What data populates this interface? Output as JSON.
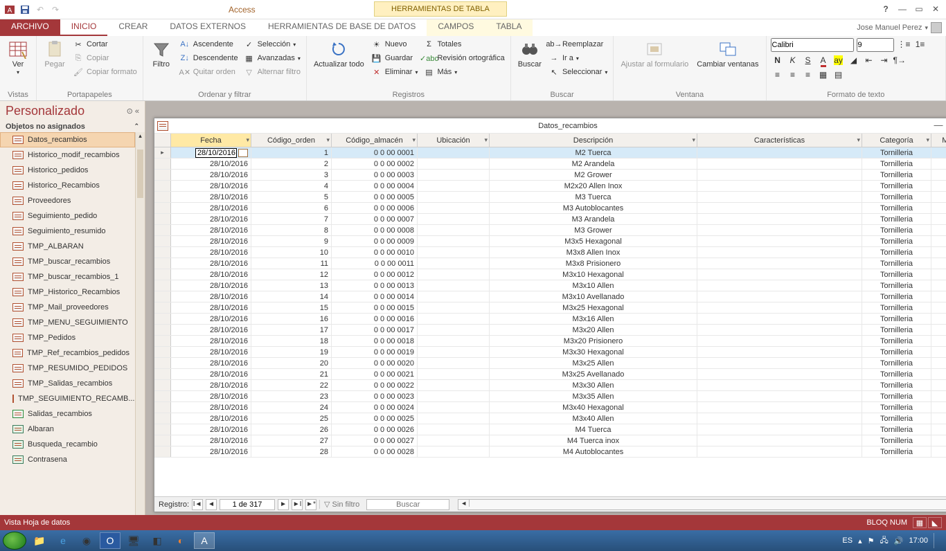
{
  "titlebar": {
    "app_title": "Access",
    "context_group": "HERRAMIENTAS DE TABLA"
  },
  "tabs": {
    "file": "ARCHIVO",
    "home": "INICIO",
    "create": "CREAR",
    "external": "DATOS EXTERNOS",
    "dbtools": "HERRAMIENTAS DE BASE DE DATOS",
    "fields": "CAMPOS",
    "table": "TABLA"
  },
  "user_name": "Jose Manuel Perez",
  "ribbon": {
    "views": {
      "btn": "Ver",
      "label": "Vistas"
    },
    "clipboard": {
      "paste": "Pegar",
      "cut": "Cortar",
      "copy": "Copiar",
      "format_painter": "Copiar formato",
      "label": "Portapapeles"
    },
    "sortfilter": {
      "filter": "Filtro",
      "asc": "Ascendente",
      "desc": "Descendente",
      "clear_sort": "Quitar orden",
      "selection": "Selección",
      "advanced": "Avanzadas",
      "toggle_filter": "Alternar filtro",
      "label": "Ordenar y filtrar"
    },
    "records": {
      "refresh": "Actualizar todo",
      "new": "Nuevo",
      "save": "Guardar",
      "delete": "Eliminar",
      "totals": "Totales",
      "spelling": "Revisión ortográfica",
      "more": "Más",
      "label": "Registros"
    },
    "find": {
      "find": "Buscar",
      "replace": "Reemplazar",
      "goto": "Ir a",
      "select": "Seleccionar",
      "label": "Buscar"
    },
    "window": {
      "size_to_fit": "Ajustar al formulario",
      "switch": "Cambiar ventanas",
      "label": "Ventana"
    },
    "textfmt": {
      "font_name": "Calibri",
      "font_size": "9",
      "label": "Formato de texto"
    }
  },
  "nav": {
    "title": "Personalizado",
    "subtitle": "Objetos no asignados",
    "items": [
      "Datos_recambios",
      "Historico_modif_recambios",
      "Historico_pedidos",
      "Historico_Recambios",
      "Proveedores",
      "Seguimiento_pedido",
      "Seguimiento_resumido",
      "TMP_ALBARAN",
      "TMP_buscar_recambios",
      "TMP_buscar_recambios_1",
      "TMP_Historico_Recambios",
      "TMP_Mail_proveedores",
      "TMP_MENU_SEGUIMIENTO",
      "TMP_Pedidos",
      "TMP_Ref_recambios_pedidos",
      "TMP_RESUMIDO_PEDIDOS",
      "TMP_Salidas_recambios",
      "TMP_SEGUIMIENTO_RECAMB...",
      "Salidas_recambios",
      "Albaran",
      "Busqueda_recambio",
      "Contrasena"
    ]
  },
  "doc": {
    "title": "Datos_recambios",
    "columns": [
      "Fecha",
      "Código_orden",
      "Código_almacén",
      "Ubicación",
      "Descripción",
      "Características",
      "Categoría",
      "Mont"
    ],
    "active_cell_value": "28/10/2016",
    "rows": [
      [
        "28/10/2016",
        "1",
        "0 0 00 0001",
        "",
        "M2 Tuerca",
        "",
        "Tornilleria"
      ],
      [
        "28/10/2016",
        "2",
        "0 0 00 0002",
        "",
        "M2 Arandela",
        "",
        "Tornilleria"
      ],
      [
        "28/10/2016",
        "3",
        "0 0 00 0003",
        "",
        "M2 Grower",
        "",
        "Tornilleria"
      ],
      [
        "28/10/2016",
        "4",
        "0 0 00 0004",
        "",
        "M2x20 Allen Inox",
        "",
        "Tornilleria"
      ],
      [
        "28/10/2016",
        "5",
        "0 0 00 0005",
        "",
        "M3 Tuerca",
        "",
        "Tornilleria"
      ],
      [
        "28/10/2016",
        "6",
        "0 0 00 0006",
        "",
        "M3 Autoblocantes",
        "",
        "Tornilleria"
      ],
      [
        "28/10/2016",
        "7",
        "0 0 00 0007",
        "",
        "M3 Arandela",
        "",
        "Tornilleria"
      ],
      [
        "28/10/2016",
        "8",
        "0 0 00 0008",
        "",
        "M3 Grower",
        "",
        "Tornilleria"
      ],
      [
        "28/10/2016",
        "9",
        "0 0 00 0009",
        "",
        "M3x5 Hexagonal",
        "",
        "Tornilleria"
      ],
      [
        "28/10/2016",
        "10",
        "0 0 00 0010",
        "",
        "M3x8 Allen Inox",
        "",
        "Tornilleria"
      ],
      [
        "28/10/2016",
        "11",
        "0 0 00 0011",
        "",
        "M3x8 Prisionero",
        "",
        "Tornilleria"
      ],
      [
        "28/10/2016",
        "12",
        "0 0 00 0012",
        "",
        "M3x10 Hexagonal",
        "",
        "Tornilleria"
      ],
      [
        "28/10/2016",
        "13",
        "0 0 00 0013",
        "",
        "M3x10 Allen",
        "",
        "Tornilleria"
      ],
      [
        "28/10/2016",
        "14",
        "0 0 00 0014",
        "",
        "M3x10 Avellanado",
        "",
        "Tornilleria"
      ],
      [
        "28/10/2016",
        "15",
        "0 0 00 0015",
        "",
        "M3x25 Hexagonal",
        "",
        "Tornilleria"
      ],
      [
        "28/10/2016",
        "16",
        "0 0 00 0016",
        "",
        "M3x16 Allen",
        "",
        "Tornilleria"
      ],
      [
        "28/10/2016",
        "17",
        "0 0 00 0017",
        "",
        "M3x20 Allen",
        "",
        "Tornilleria"
      ],
      [
        "28/10/2016",
        "18",
        "0 0 00 0018",
        "",
        "M3x20 Prisionero",
        "",
        "Tornilleria"
      ],
      [
        "28/10/2016",
        "19",
        "0 0 00 0019",
        "",
        "M3x30 Hexagonal",
        "",
        "Tornilleria"
      ],
      [
        "28/10/2016",
        "20",
        "0 0 00 0020",
        "",
        "M3x25 Allen",
        "",
        "Tornilleria"
      ],
      [
        "28/10/2016",
        "21",
        "0 0 00 0021",
        "",
        "M3x25 Avellanado",
        "",
        "Tornilleria"
      ],
      [
        "28/10/2016",
        "22",
        "0 0 00 0022",
        "",
        "M3x30 Allen",
        "",
        "Tornilleria"
      ],
      [
        "28/10/2016",
        "23",
        "0 0 00 0023",
        "",
        "M3x35 Allen",
        "",
        "Tornilleria"
      ],
      [
        "28/10/2016",
        "24",
        "0 0 00 0024",
        "",
        "M3x40 Hexagonal",
        "",
        "Tornilleria"
      ],
      [
        "28/10/2016",
        "25",
        "0 0 00 0025",
        "",
        "M3x40 Allen",
        "",
        "Tornilleria"
      ],
      [
        "28/10/2016",
        "26",
        "0 0 00 0026",
        "",
        "M4 Tuerca",
        "",
        "Tornilleria"
      ],
      [
        "28/10/2016",
        "27",
        "0 0 00 0027",
        "",
        "M4 Tuerca inox",
        "",
        "Tornilleria"
      ],
      [
        "28/10/2016",
        "28",
        "0 0 00 0028",
        "",
        "M4 Autoblocantes",
        "",
        "Tornilleria"
      ]
    ],
    "recnav": {
      "label": "Registro:",
      "position": "1 de 317",
      "no_filter": "Sin filtro",
      "search_ph": "Buscar"
    }
  },
  "status": {
    "left": "Vista Hoja de datos",
    "numlock": "BLOQ NUM"
  },
  "taskbar": {
    "lang": "ES",
    "time": "17:00"
  }
}
